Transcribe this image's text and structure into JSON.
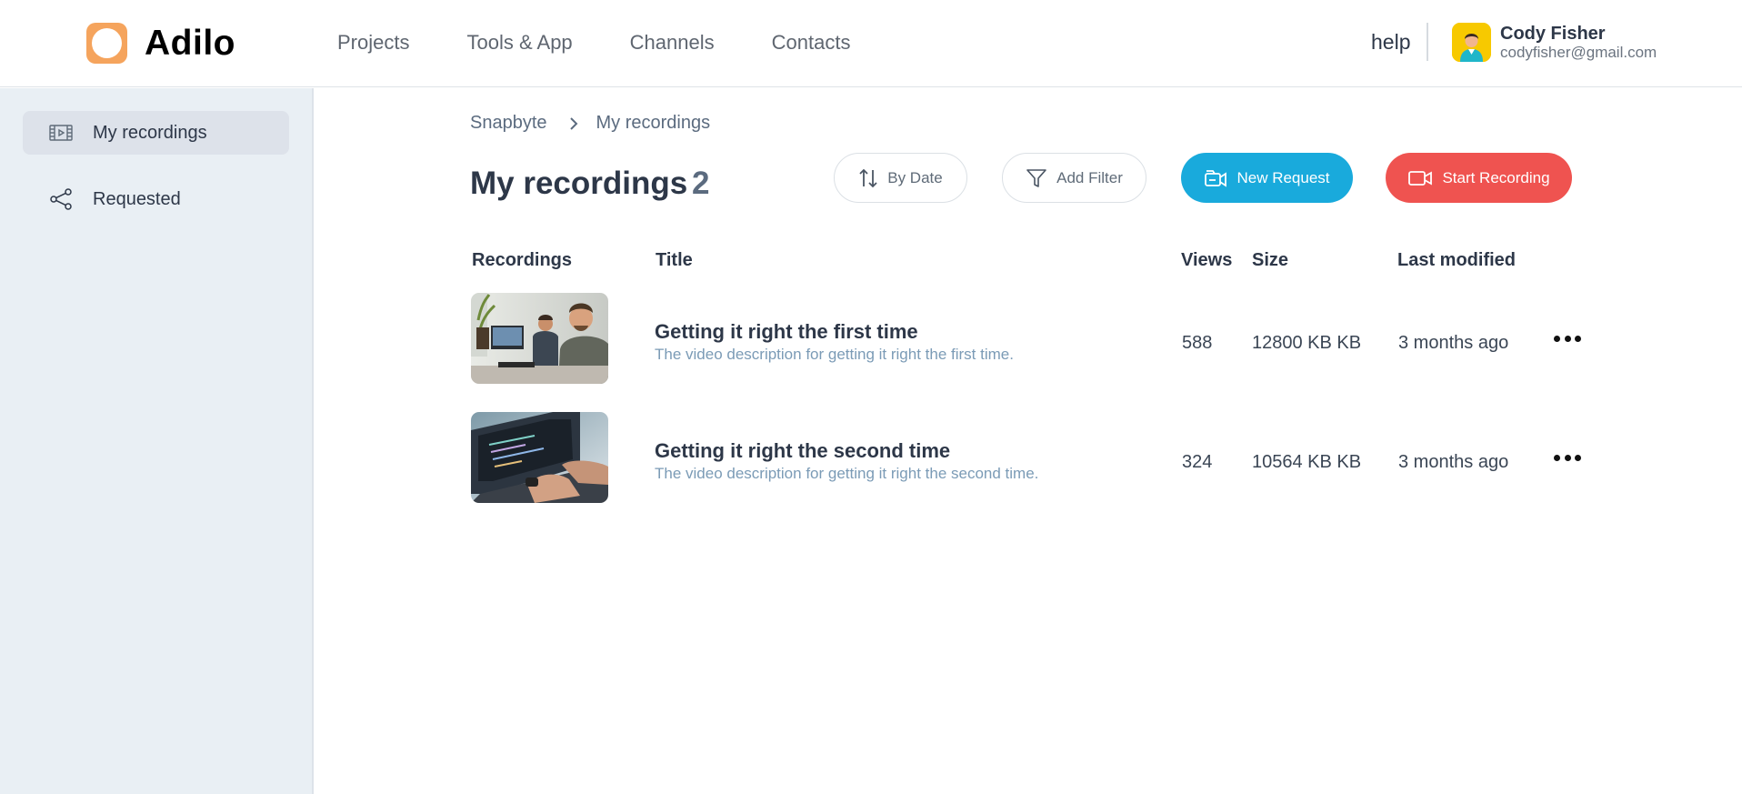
{
  "brand": {
    "name": "Adilo",
    "color": "#f5a45d"
  },
  "nav": {
    "items": [
      "Projects",
      "Tools & App",
      "Channels",
      "Contacts"
    ],
    "help": "help"
  },
  "user": {
    "name": "Cody Fisher",
    "email": "codyfisher@gmail.com",
    "avatar_icon": "user-avatar"
  },
  "sidebar": {
    "items": [
      {
        "label": "My recordings",
        "icon": "film-icon",
        "active": true
      },
      {
        "label": "Requested",
        "icon": "share-icon",
        "active": false
      }
    ]
  },
  "breadcrumb": {
    "root": "Snapbyte",
    "current": "My recordings"
  },
  "main": {
    "title": "My recordings",
    "count": "2",
    "buttons": {
      "sort": "By Date",
      "filter": "Add Filter",
      "new_request": "New Request",
      "start_recording": "Start Recording"
    },
    "colors": {
      "primary": "#19aadc",
      "danger": "#ef5350"
    }
  },
  "table": {
    "columns": [
      "Recordings",
      "Title",
      "Views",
      "Size",
      "Last modified"
    ],
    "rows": [
      {
        "title": "Getting it right the first time",
        "description": "The video description for getting it right the first time.",
        "views": "588",
        "size": "12800 KB KB",
        "modified": "3 months ago"
      },
      {
        "title": "Getting it right the second time",
        "description": "The video description for getting it right the second time.",
        "views": "324",
        "size": "10564 KB KB",
        "modified": "3 months ago"
      }
    ]
  }
}
